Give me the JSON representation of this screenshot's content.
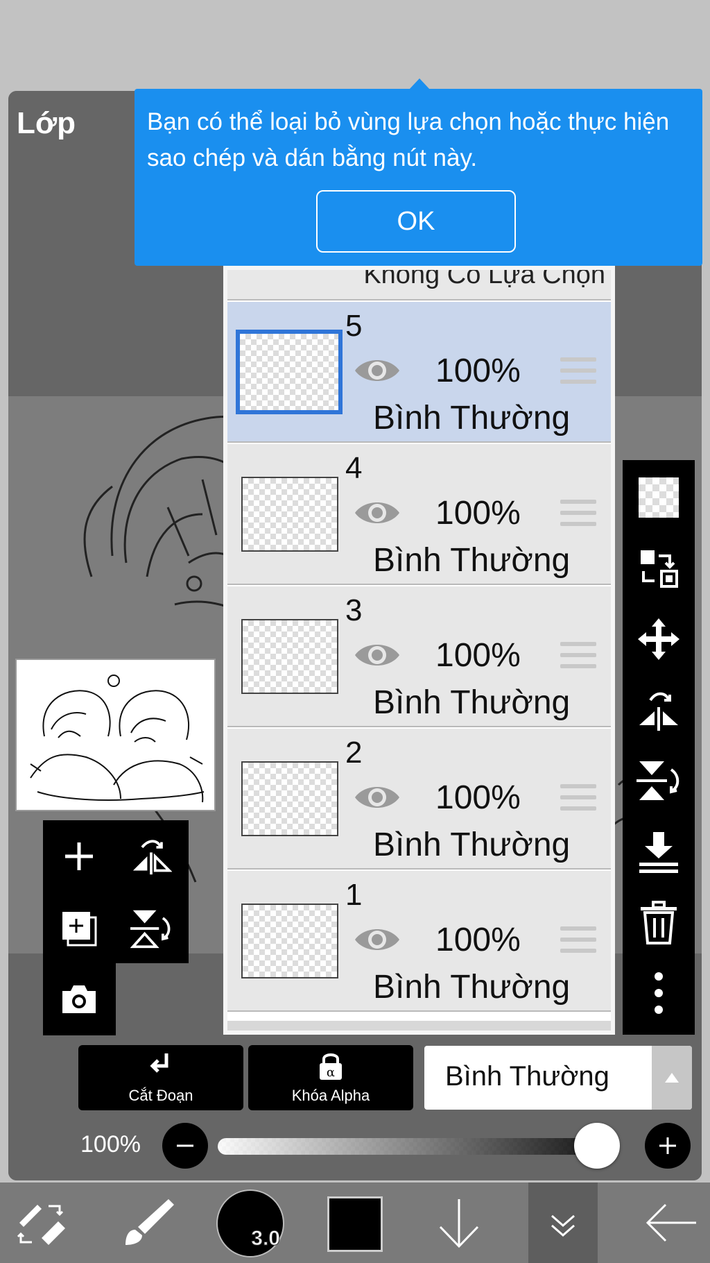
{
  "panel": {
    "title": "Lớp"
  },
  "tooltip": {
    "message": "Bạn có thể loại bỏ vùng lựa chọn hoặc thực hiện sao chép và dán bằng nút này.",
    "ok_label": "OK"
  },
  "layers": {
    "selection_label": "Không Có Lựa Chọn",
    "items": [
      {
        "number": "5",
        "opacity": "100%",
        "blend": "Bình Thường",
        "selected": true
      },
      {
        "number": "4",
        "opacity": "100%",
        "blend": "Bình Thường",
        "selected": false
      },
      {
        "number": "3",
        "opacity": "100%",
        "blend": "Bình Thường",
        "selected": false
      },
      {
        "number": "2",
        "opacity": "100%",
        "blend": "Bình Thường",
        "selected": false
      },
      {
        "number": "1",
        "opacity": "100%",
        "blend": "Bình Thường",
        "selected": false
      }
    ]
  },
  "right_tools": [
    "transparency-icon",
    "swap-selection-icon",
    "move-icon",
    "flip-horizontal-icon",
    "flip-vertical-icon",
    "merge-down-icon",
    "trash-icon",
    "more-vertical-icon"
  ],
  "left_tools": [
    "add-layer-icon",
    "flip-layer-horizontal-icon",
    "duplicate-layer-icon",
    "flip-layer-vertical-icon",
    "camera-icon"
  ],
  "controls": {
    "clipping_label": "Cắt Đoạn",
    "alpha_lock_label": "Khóa Alpha",
    "blend_mode": "Bình Thường",
    "opacity_label": "100%",
    "opacity_value": 1.0
  },
  "toolbar": {
    "brush_size": "3.0",
    "current_color": "#000000",
    "icons": [
      "transform-eraser-icon",
      "brush-icon",
      "brush-size-icon",
      "color-swatch",
      "down-arrow-icon",
      "layers-chevron-icon",
      "back-arrow-icon"
    ]
  },
  "colors": {
    "accent": "#1a8fef",
    "selected_row": "#c9d6ec",
    "selected_border": "#2f75d8"
  }
}
